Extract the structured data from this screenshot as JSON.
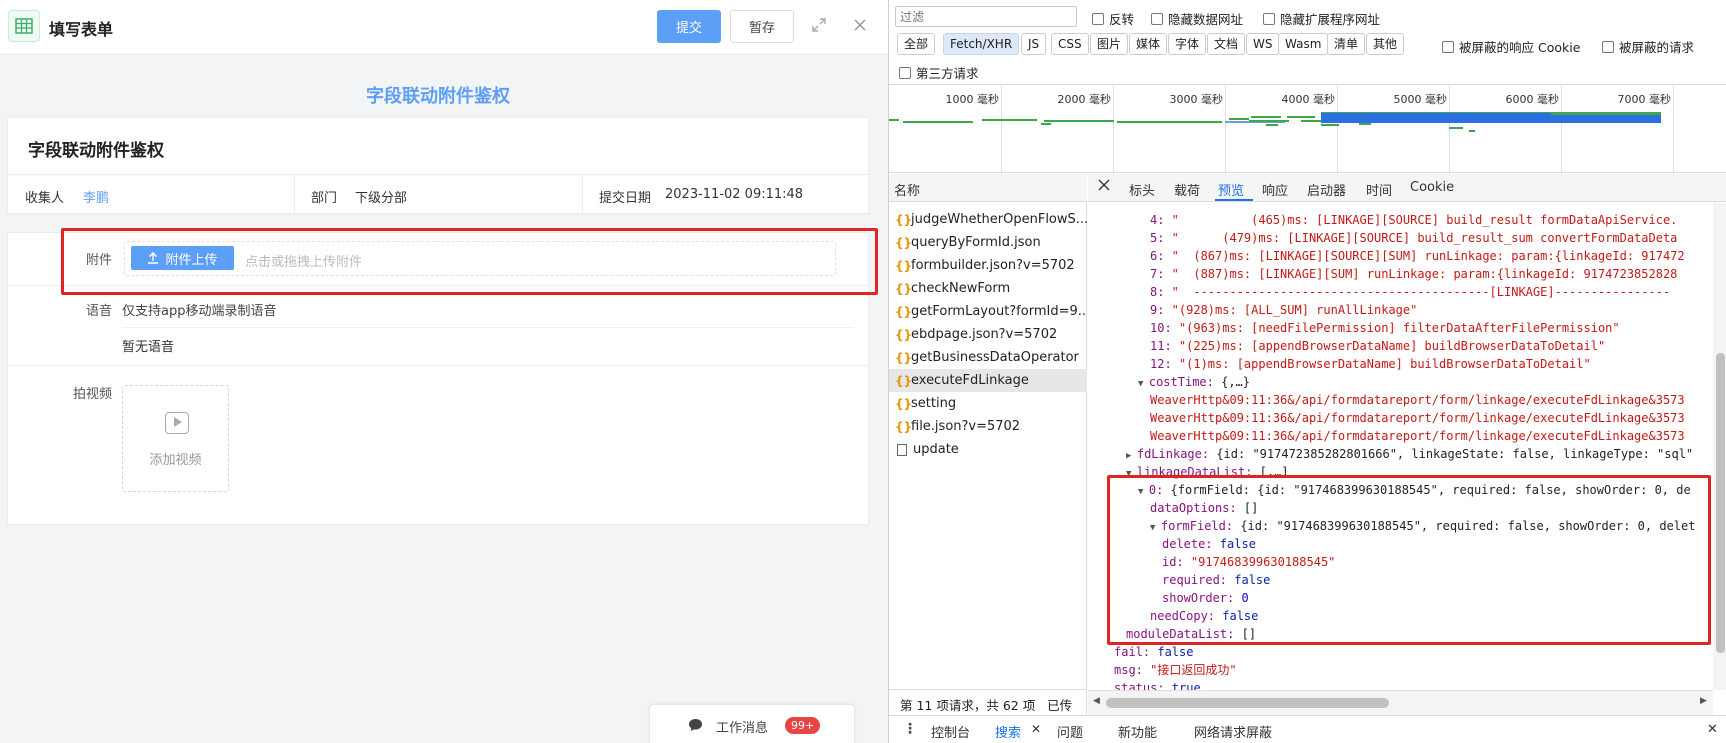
{
  "app": {
    "title": "填写表单",
    "submit_label": "提交",
    "save_label": "暂存",
    "form_heading": "字段联动附件鉴权",
    "card_title": "字段联动附件鉴权",
    "meta": {
      "collector_label": "收集人",
      "collector_value": "李鹏",
      "dept_label": "部门",
      "dept_value": "下级分部",
      "date_label": "提交日期",
      "date_value": "2023-11-02 09:11:48"
    },
    "attachment": {
      "label": "附件",
      "button_label": "附件上传",
      "hint": "点击或拖拽上传附件"
    },
    "voice": {
      "label": "语音",
      "note": "仅支持app移动端录制语音",
      "empty": "暂无语音"
    },
    "video": {
      "label": "拍视频",
      "add_label": "添加视频"
    },
    "work_message": {
      "label": "工作消息",
      "badge": "99+"
    }
  },
  "devtools": {
    "filter_placeholder": "过滤",
    "checkboxes_row1": [
      "反转",
      "隐藏数据网址",
      "隐藏扩展程序网址"
    ],
    "type_filters": [
      "全部",
      "Fetch/XHR",
      "JS",
      "CSS",
      "图片",
      "媒体",
      "字体",
      "文档",
      "WS",
      "Wasm",
      "清单",
      "其他"
    ],
    "active_type": "Fetch/XHR",
    "checkboxes_row2": [
      "被屏蔽的响应 Cookie",
      "被屏蔽的请求"
    ],
    "third_party_label": "第三方请求",
    "timeline_labels": [
      "1000 毫秒",
      "2000 毫秒",
      "3000 毫秒",
      "4000 毫秒",
      "5000 毫秒",
      "6000 毫秒",
      "7000 毫秒"
    ],
    "name_header": "名称",
    "requests": [
      "judgeWhetherOpenFlowS...",
      "queryByFormId.json",
      "formbuilder.json?v=5702",
      "checkNewForm",
      "getFormLayout?formId=9...",
      "ebdpage.json?v=5702",
      "getBusinessDataOperator",
      "executeFdLinkage",
      "setting",
      "file.json?v=5702",
      "update"
    ],
    "selected_request": "executeFdLinkage",
    "status_text": "第 11 项请求，共 62 项",
    "status_text_tail": "已传",
    "detail_tabs": [
      "标头",
      "载荷",
      "预览",
      "响应",
      "启动器",
      "时间",
      "Cookie"
    ],
    "active_detail_tab": "预览",
    "preview_lines": [
      {
        "indent": 5,
        "tri": "",
        "k": "4:",
        "v": " \"          (465)ms: [LINKAGE][SOURCE] build_result formDataApiService.",
        "cls": "s"
      },
      {
        "indent": 5,
        "tri": "",
        "k": "5:",
        "v": " \"      (479)ms: [LINKAGE][SOURCE] build_result_sum convertFormDataDeta",
        "cls": "s"
      },
      {
        "indent": 5,
        "tri": "",
        "k": "6:",
        "v": " \"  (867)ms: [LINKAGE][SOURCE][SUM] runLinkage: param:{linkageId: 917472",
        "cls": "s"
      },
      {
        "indent": 5,
        "tri": "",
        "k": "7:",
        "v": " \"  (887)ms: [LINKAGE][SUM] runLinkage: param:{linkageId: 9174723852828",
        "cls": "s"
      },
      {
        "indent": 5,
        "tri": "",
        "k": "8:",
        "v": " \"  -----------------------------------------[LINKAGE]----------------",
        "cls": "s"
      },
      {
        "indent": 5,
        "tri": "",
        "k": "9:",
        "v": " \"(928)ms: [ALL_SUM] runAllLinkage\"",
        "cls": "s"
      },
      {
        "indent": 5,
        "tri": "",
        "k": "10:",
        "v": " \"(963)ms: [needFilePermission] filterDataAfterFilePermission\"",
        "cls": "s"
      },
      {
        "indent": 5,
        "tri": "",
        "k": "11:",
        "v": " \"(225)ms: [appendBrowserDataName] buildBrowserDataToDetail\"",
        "cls": "s"
      },
      {
        "indent": 5,
        "tri": "",
        "k": "12:",
        "v": " \"(1)ms: [appendBrowserDataName] buildBrowserDataToDetail\"",
        "cls": "s"
      },
      {
        "indent": 4,
        "tri": "▼",
        "k": "costTime:",
        "v": " {,…}",
        "cls": "p"
      },
      {
        "indent": 5,
        "tri": "",
        "k": "",
        "v": "WeaverHttp&09:11:36&/api/formdatareport/form/linkage/executeFdLinkage&3573",
        "cls": "s"
      },
      {
        "indent": 5,
        "tri": "",
        "k": "",
        "v": "WeaverHttp&09:11:36&/api/formdatareport/form/linkage/executeFdLinkage&3573",
        "cls": "s"
      },
      {
        "indent": 5,
        "tri": "",
        "k": "",
        "v": "WeaverHttp&09:11:36&/api/formdatareport/form/linkage/executeFdLinkage&3573",
        "cls": "s"
      },
      {
        "indent": 3,
        "tri": "▶",
        "k": "fdLinkage:",
        "v": " {id: \"917472385282801666\", linkageState: false, linkageType: \"sql\"",
        "cls": "p"
      },
      {
        "indent": 3,
        "tri": "▼",
        "k": "linkageDataList:",
        "v": " [,…]",
        "cls": "p"
      },
      {
        "indent": 4,
        "tri": "▼",
        "k": "0:",
        "v": " {formField: {id: \"917468399630188545\", required: false, showOrder: 0, de",
        "cls": "p"
      },
      {
        "indent": 5,
        "tri": "",
        "k": "dataOptions:",
        "v": " []",
        "cls": "p"
      },
      {
        "indent": 5,
        "tri": "▼",
        "k": "formField:",
        "v": " {id: \"917468399630188545\", required: false, showOrder: 0, delet",
        "cls": "p"
      },
      {
        "indent": 6,
        "tri": "",
        "k": "delete:",
        "v": " false",
        "cls": "b"
      },
      {
        "indent": 6,
        "tri": "",
        "k": "id:",
        "v": " \"917468399630188545\"",
        "cls": "s"
      },
      {
        "indent": 6,
        "tri": "",
        "k": "required:",
        "v": " false",
        "cls": "b"
      },
      {
        "indent": 6,
        "tri": "",
        "k": "showOrder:",
        "v": " 0",
        "cls": "n"
      },
      {
        "indent": 5,
        "tri": "",
        "k": "needCopy:",
        "v": " false",
        "cls": "b"
      },
      {
        "indent": 3,
        "tri": "",
        "k": "moduleDataList:",
        "v": " []",
        "cls": "p"
      },
      {
        "indent": 2,
        "tri": "",
        "k": "fail:",
        "v": " false",
        "cls": "b"
      },
      {
        "indent": 2,
        "tri": "",
        "k": "msg:",
        "v": " \"接口返回成功\"",
        "cls": "s"
      },
      {
        "indent": 2,
        "tri": "",
        "k": "status:",
        "v": " true",
        "cls": "b"
      }
    ],
    "drawer_tabs": [
      "控制台",
      "搜索",
      "问题",
      "新功能",
      "网络请求屏蔽"
    ],
    "active_drawer_tab": "搜索"
  }
}
